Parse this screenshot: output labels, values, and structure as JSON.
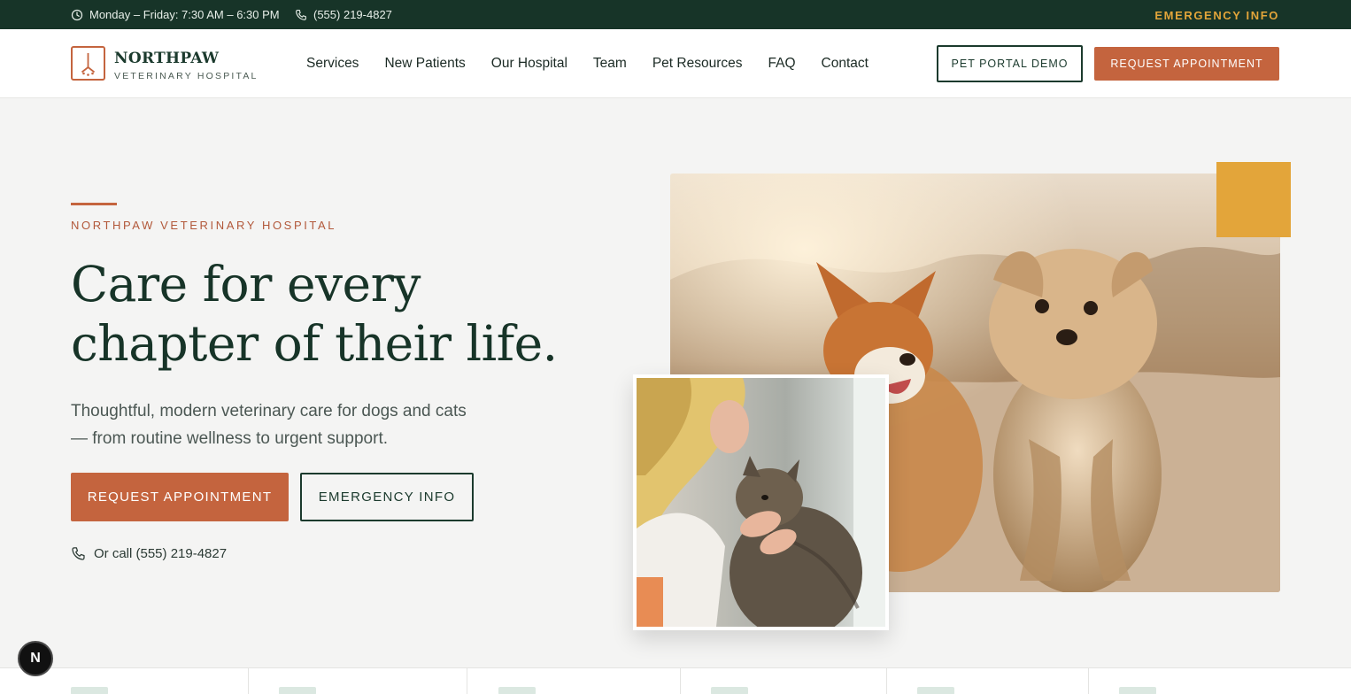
{
  "topbar": {
    "hours": "Monday – Friday: 7:30 AM – 6:30 PM",
    "phone": "(555) 219-4827",
    "emergency": "EMERGENCY INFO"
  },
  "brand": {
    "name": "NORTHPAW",
    "subtitle": "VETERINARY HOSPITAL"
  },
  "nav": {
    "items": [
      {
        "label": "Services"
      },
      {
        "label": "New Patients"
      },
      {
        "label": "Our Hospital"
      },
      {
        "label": "Team"
      },
      {
        "label": "Pet Resources"
      },
      {
        "label": "FAQ"
      },
      {
        "label": "Contact"
      }
    ]
  },
  "header": {
    "portal_label": "PET PORTAL DEMO",
    "request_label": "REQUEST APPOINTMENT"
  },
  "hero": {
    "eyebrow": "NORTHPAW VETERINARY HOSPITAL",
    "headline_line1": "Care for every",
    "headline_line2": "chapter of their life.",
    "sub_line1": "Thoughtful, modern veterinary care for dogs and cats",
    "sub_line2": "— from routine wellness to urgent support.",
    "primary_cta": "REQUEST APPOINTMENT",
    "secondary_cta": "EMERGENCY INFO",
    "call_text": "Or call (555) 219-4827"
  },
  "badge": {
    "letter": "N"
  },
  "colors": {
    "dark_green": "#173428",
    "terracotta": "#c4643e",
    "gold": "#e3a53a",
    "background": "#f4f4f3"
  },
  "icons": [
    "clock-icon",
    "phone-icon",
    "logo-icon"
  ]
}
